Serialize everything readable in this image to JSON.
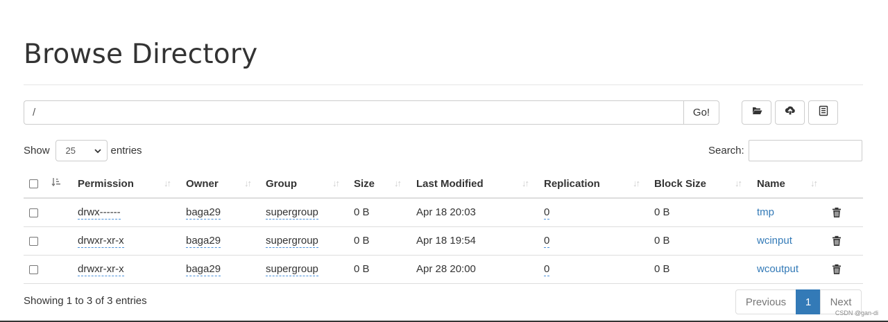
{
  "page": {
    "title": "Browse Directory"
  },
  "path_bar": {
    "value": "/",
    "go_label": "Go!"
  },
  "toolbar": {
    "icons": [
      "folder-open-icon",
      "upload-icon",
      "list-icon"
    ]
  },
  "length": {
    "show_label": "Show",
    "selected": "25",
    "entries_label": "entries"
  },
  "search": {
    "label": "Search:",
    "value": ""
  },
  "table": {
    "columns": [
      "Permission",
      "Owner",
      "Group",
      "Size",
      "Last Modified",
      "Replication",
      "Block Size",
      "Name"
    ],
    "rows": [
      {
        "permission": "drwx------",
        "owner": "baga29",
        "group": "supergroup",
        "size": "0 B",
        "modified": "Apr 18 20:03",
        "replication": "0",
        "block_size": "0 B",
        "name": "tmp"
      },
      {
        "permission": "drwxr-xr-x",
        "owner": "baga29",
        "group": "supergroup",
        "size": "0 B",
        "modified": "Apr 18 19:54",
        "replication": "0",
        "block_size": "0 B",
        "name": "wcinput"
      },
      {
        "permission": "drwxr-xr-x",
        "owner": "baga29",
        "group": "supergroup",
        "size": "0 B",
        "modified": "Apr 28 20:00",
        "replication": "0",
        "block_size": "0 B",
        "name": "wcoutput"
      }
    ]
  },
  "footer": {
    "info": "Showing 1 to 3 of 3 entries",
    "previous": "Previous",
    "current_page": "1",
    "next": "Next"
  },
  "watermark": "CSDN @gan-di",
  "colors": {
    "link": "#337ab7",
    "active_page": "#337ab7",
    "border": "#dddddd"
  }
}
